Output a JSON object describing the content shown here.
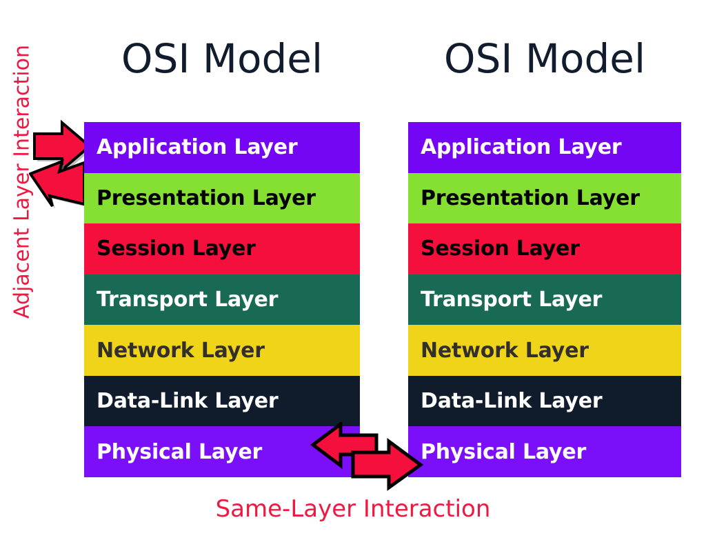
{
  "diagram": {
    "title": "OSI Model",
    "background_color": "#ffffff"
  },
  "columns": [
    {
      "id": "left",
      "title": "OSI Model",
      "layers": [
        {
          "name": "Application Layer",
          "bg": "#7406f5",
          "fg": "#ffffff"
        },
        {
          "name": "Presentation Layer",
          "bg": "#86e032",
          "fg": "#000000"
        },
        {
          "name": "Session Layer",
          "bg": "#f50f3c",
          "fg": "#000000"
        },
        {
          "name": "Transport Layer",
          "bg": "#186a55",
          "fg": "#ffffff"
        },
        {
          "name": "Network Layer",
          "bg": "#f0d419",
          "fg": "#33302a"
        },
        {
          "name": "Data-Link Layer",
          "bg": "#101b2b",
          "fg": "#ffffff"
        },
        {
          "name": "Physical Layer",
          "bg": "#7c0ffa",
          "fg": "#ffffff"
        }
      ]
    },
    {
      "id": "right",
      "title": "OSI Model",
      "layers": [
        {
          "name": "Application Layer",
          "bg": "#7406f5",
          "fg": "#ffffff"
        },
        {
          "name": "Presentation Layer",
          "bg": "#86e032",
          "fg": "#000000"
        },
        {
          "name": "Session Layer",
          "bg": "#f50f3c",
          "fg": "#000000"
        },
        {
          "name": "Transport Layer",
          "bg": "#186a55",
          "fg": "#ffffff"
        },
        {
          "name": "Network Layer",
          "bg": "#f0d419",
          "fg": "#33302a"
        },
        {
          "name": "Data-Link Layer",
          "bg": "#101b2b",
          "fg": "#ffffff"
        },
        {
          "name": "Physical Layer",
          "bg": "#7c0ffa",
          "fg": "#ffffff"
        }
      ]
    }
  ],
  "annotations": {
    "adjacent_layer_interaction": "Adjacent Layer Interaction",
    "same_layer_interaction": "Same-Layer Interaction",
    "caption_color": "#ef1840",
    "arrow_fill": "#f50f3c",
    "arrow_stroke": "#000000"
  }
}
